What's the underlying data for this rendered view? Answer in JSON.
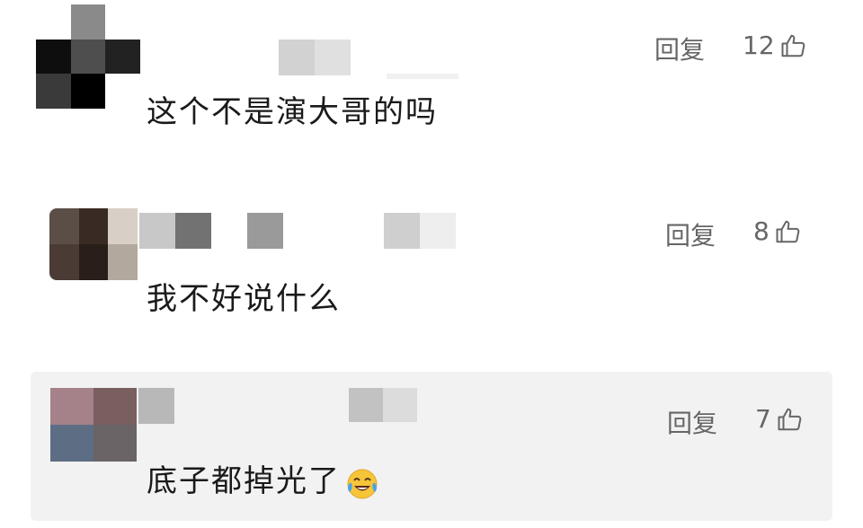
{
  "comments": [
    {
      "text": "这个不是演大哥的吗",
      "reply_label": "回复",
      "like_count": "12"
    },
    {
      "text": "我不好说什么",
      "reply_label": "回复",
      "like_count": "8"
    },
    {
      "text": "底子都掉光了",
      "reply_label": "回复",
      "like_count": "7",
      "emoji": "face-with-tears-of-joy"
    }
  ],
  "icons": {
    "like": "thumbs-up-icon"
  },
  "colors": {
    "text": "#1a1a1a",
    "secondary": "#666666",
    "highlight_bg": "#f2f2f2"
  }
}
